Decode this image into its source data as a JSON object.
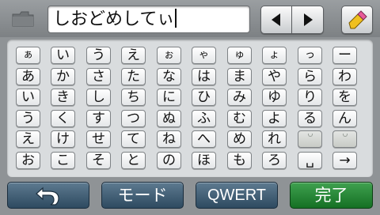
{
  "input": {
    "text": "しおどめしてぃ"
  },
  "keys": [
    [
      "ぁ",
      "い",
      "う",
      "え",
      "ぉ",
      "ゃ",
      "ゅ",
      "ょ",
      "っ",
      "ー"
    ],
    [
      "あ",
      "か",
      "さ",
      "た",
      "な",
      "は",
      "ま",
      "や",
      "ら",
      "わ"
    ],
    [
      "い",
      "き",
      "し",
      "ち",
      "に",
      "ひ",
      "み",
      "ゆ",
      "り",
      "を"
    ],
    [
      "う",
      "く",
      "す",
      "つ",
      "ぬ",
      "ふ",
      "む",
      "よ",
      "る",
      "ん"
    ],
    [
      "え",
      "け",
      "せ",
      "て",
      "ね",
      "へ",
      "め",
      "れ",
      "",
      ""
    ],
    [
      "お",
      "こ",
      "そ",
      "と",
      "の",
      "ほ",
      "も",
      "ろ",
      "␣",
      "→"
    ]
  ],
  "buttons": {
    "mode": "モード",
    "qwert": "QWERT",
    "done": "完了"
  },
  "icons": {
    "folder": "folder-icon",
    "cursor_left": "triangle-left-icon",
    "cursor_right": "triangle-right-icon",
    "eraser": "eraser-icon",
    "back": "back-arrow-icon"
  },
  "colors": {
    "done_button": "#2a8a3a",
    "nav_button": "#3f5d74",
    "key_face": "#ffffff"
  }
}
